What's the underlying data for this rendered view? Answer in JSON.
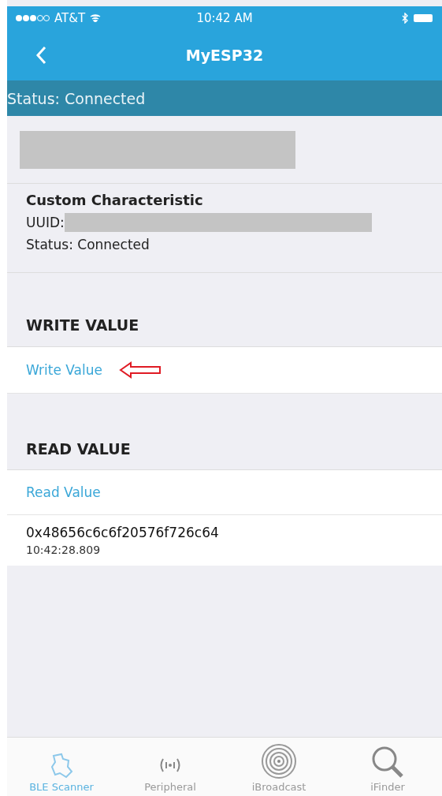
{
  "status_bar": {
    "carrier": "AT&T",
    "time": "10:42 AM"
  },
  "nav": {
    "title": "MyESP32"
  },
  "connection_status": "Status: Connected",
  "characteristic": {
    "name": "Custom Characteristic",
    "uuid_label": "UUID:",
    "status": "Status: Connected"
  },
  "write_section": {
    "header": "WRITE VALUE",
    "action": "Write Value"
  },
  "read_section": {
    "header": "READ VALUE",
    "action": "Read Value",
    "value": "0x48656c6c6f20576f726c64",
    "timestamp": "10:42:28.809"
  },
  "tabs": [
    {
      "kind": "scanner",
      "label": "BLE Scanner",
      "selected": true
    },
    {
      "kind": "peripheral",
      "label": "Peripheral",
      "selected": false
    },
    {
      "kind": "broadcast",
      "label": "iBroadcast",
      "selected": false
    },
    {
      "kind": "finder",
      "label": "iFinder",
      "selected": false
    }
  ]
}
